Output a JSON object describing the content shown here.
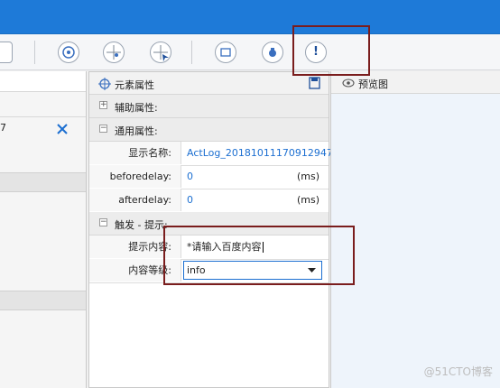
{
  "colors": {
    "accent": "#1e7ad8",
    "annotation": "#7a1d1d",
    "value_blue": "#1c6fd1"
  },
  "toolbar": {
    "icons": [
      "list-icon",
      "target-icon",
      "target-dot-icon",
      "target-cursor-icon",
      "message-icon",
      "robot-icon",
      "alert-icon"
    ]
  },
  "left_panel": {
    "partial_value": "7"
  },
  "properties": {
    "title": "元素属性",
    "sections": {
      "auxiliary": "辅助属性:",
      "general": "通用属性:",
      "trigger": "触发 - 提示:"
    },
    "display_name": {
      "label": "显示名称:",
      "value": "ActLog_20181011170912947"
    },
    "before_delay": {
      "label": "beforedelay:",
      "value": "0",
      "unit": "(ms)"
    },
    "after_delay": {
      "label": "afterdelay:",
      "value": "0",
      "unit": "(ms)"
    },
    "hint_content": {
      "label": "提示内容:",
      "value": "*请输入百度内容"
    },
    "content_level": {
      "label": "内容等级:",
      "value": "info"
    }
  },
  "preview": {
    "title": "预览图"
  },
  "watermark": "@51CTO博客"
}
